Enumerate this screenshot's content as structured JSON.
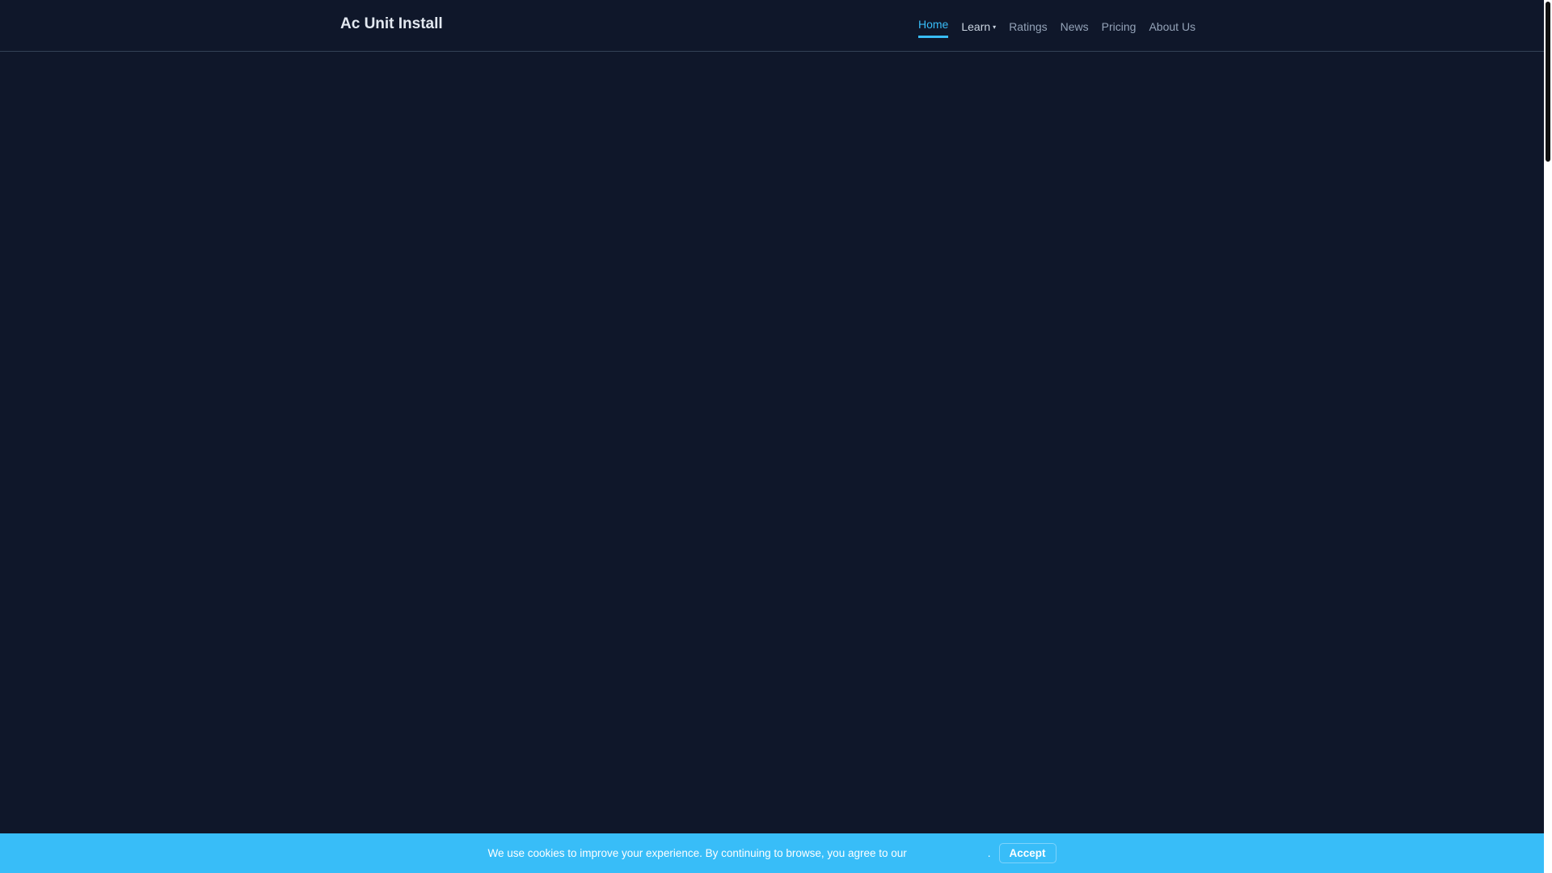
{
  "header": {
    "brand": "Ac Unit Install",
    "nav": [
      {
        "label": "Home",
        "active": true
      },
      {
        "label": "Learn",
        "caret": "▾"
      },
      {
        "label": "Ratings"
      },
      {
        "label": "News"
      },
      {
        "label": "Pricing"
      },
      {
        "label": "About Us"
      }
    ]
  },
  "cookie": {
    "text": "We use cookies to improve your experience. By continuing to browse, you agree to our",
    "period": ".",
    "accept_label": "Accept"
  },
  "colors": {
    "background": "#0f172a",
    "accent": "#38bdf8"
  }
}
